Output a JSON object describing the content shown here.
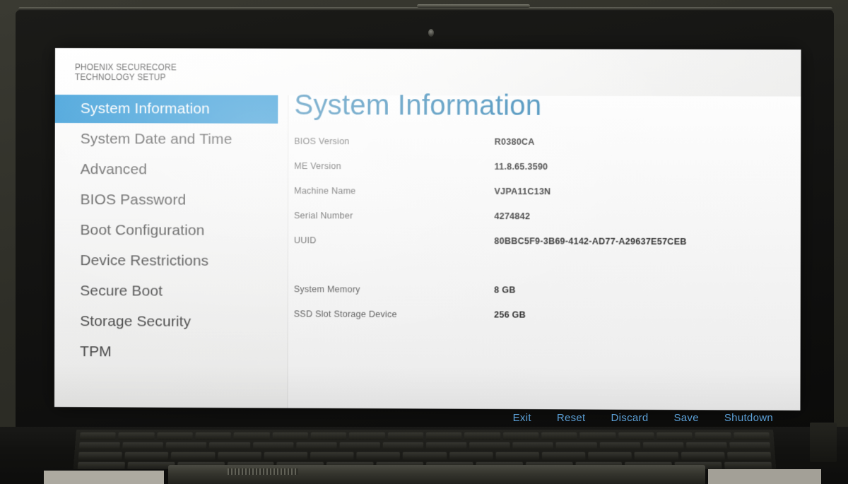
{
  "brand": {
    "title": "PHOENIX SECURECORE\nTECHNOLOGY SETUP"
  },
  "colors": {
    "nav_active_bg": "#1c8fd4",
    "nav_active_text": "#ffffff",
    "page_title": "#2e82b4",
    "action_bar_text": "#5b9fd6",
    "screen_bg": "#ffffff"
  },
  "sidebar": {
    "items": [
      {
        "label": "System Information",
        "active": true
      },
      {
        "label": "System Date and Time",
        "active": false
      },
      {
        "label": "Advanced",
        "active": false
      },
      {
        "label": "BIOS Password",
        "active": false
      },
      {
        "label": "Boot Configuration",
        "active": false
      },
      {
        "label": "Device Restrictions",
        "active": false
      },
      {
        "label": "Secure Boot",
        "active": false
      },
      {
        "label": "Storage Security",
        "active": false
      },
      {
        "label": "TPM",
        "active": false
      }
    ]
  },
  "main": {
    "title": "System Information",
    "fields_group1": [
      {
        "label": "BIOS Version",
        "value": "R0380CA"
      },
      {
        "label": "ME Version",
        "value": "11.8.65.3590"
      },
      {
        "label": "Machine Name",
        "value": "VJPA11C13N"
      },
      {
        "label": "Serial Number",
        "value": "4274842"
      },
      {
        "label": "UUID",
        "value": "80BBC5F9-3B69-4142-AD77-A29637E57CEB"
      }
    ],
    "fields_group2": [
      {
        "label": "System Memory",
        "value": "8 GB"
      },
      {
        "label": "SSD Slot Storage Device",
        "value": "256 GB"
      }
    ]
  },
  "action_bar": {
    "buttons": [
      {
        "label": "Exit"
      },
      {
        "label": "Reset"
      },
      {
        "label": "Discard"
      },
      {
        "label": "Save"
      },
      {
        "label": "Shutdown"
      }
    ]
  }
}
